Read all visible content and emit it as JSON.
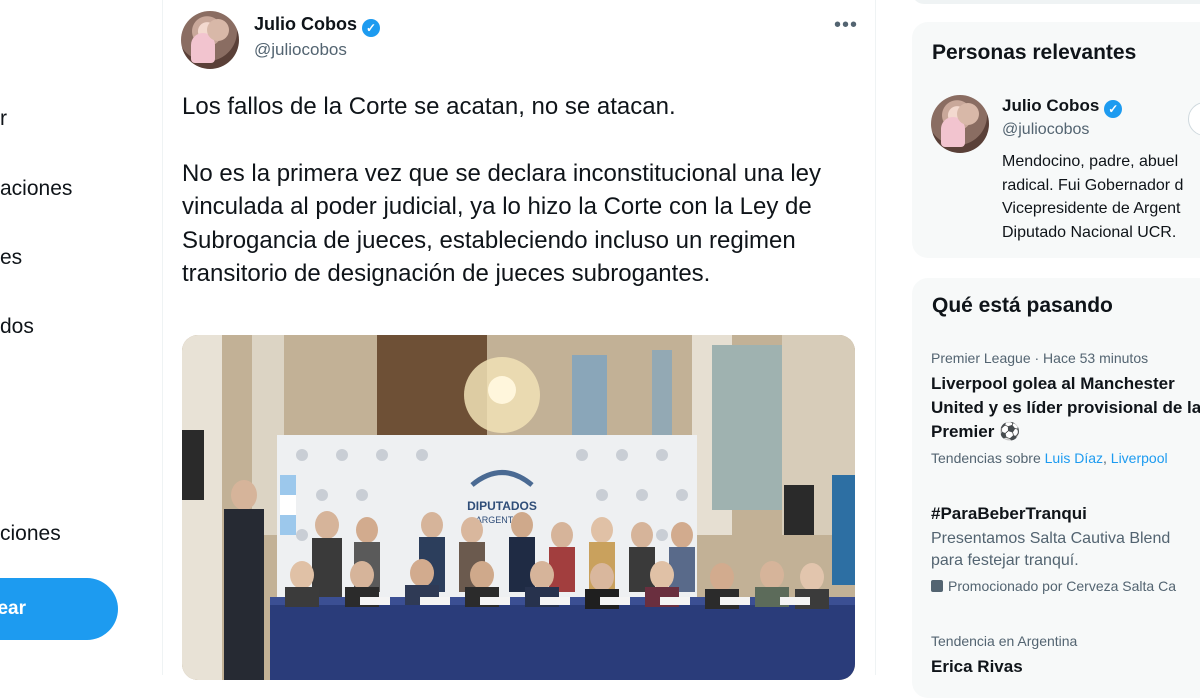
{
  "nav": {
    "items": [
      {
        "label": "r"
      },
      {
        "label": "aciones"
      },
      {
        "label": "es"
      },
      {
        "label": "dos"
      },
      {
        "label": "ciones"
      }
    ],
    "tweet_button": "ear"
  },
  "tweet": {
    "author_name": "Julio Cobos",
    "author_handle": "@juliocobos",
    "paragraph1": "Los fallos de la Corte se acatan, no se atacan.",
    "paragraph2": "No es la primera vez que se declara inconstitucional una ley vinculada al poder judicial, ya lo hizo la Corte con la Ley de Subrogancia de jueces, estableciendo incluso un regimen transitorio de designación de jueces subrogantes.",
    "photo_banner_line1": "DIPUTADOS",
    "photo_banner_line2": "ARGENTINA"
  },
  "relevant": {
    "title": "Personas relevantes",
    "name": "Julio Cobos",
    "handle": "@juliocobos",
    "bio_lines": [
      "Mendocino, padre, abuel",
      "radical. Fui Gobernador d",
      "Vicepresidente de Argent",
      "Diputado Nacional UCR."
    ]
  },
  "trends": {
    "title": "Qué está pasando",
    "t1": {
      "context": "Premier League · Hace 53 minutos",
      "line1": "Liverpool golea al Manchester",
      "line2": "United y es líder provisional de la",
      "line3": "Premier ⚽",
      "topics_prefix": "Tendencias sobre",
      "topic1": "Luis Díaz",
      "sep": ",",
      "topic2": "Liverpool"
    },
    "t2": {
      "hashtag": "#ParaBeberTranqui",
      "desc1": "Presentamos Salta Cautiva Blend",
      "desc2": "para festejar tranquí.",
      "promo": "Promocionado por Cerveza Salta Ca"
    },
    "t3": {
      "context": "Tendencia en Argentina",
      "name": "Erica Rivas"
    }
  },
  "colors": {
    "accent": "#1d9bf0",
    "secondary_text": "#536471",
    "card_bg": "#f7f9f9"
  }
}
